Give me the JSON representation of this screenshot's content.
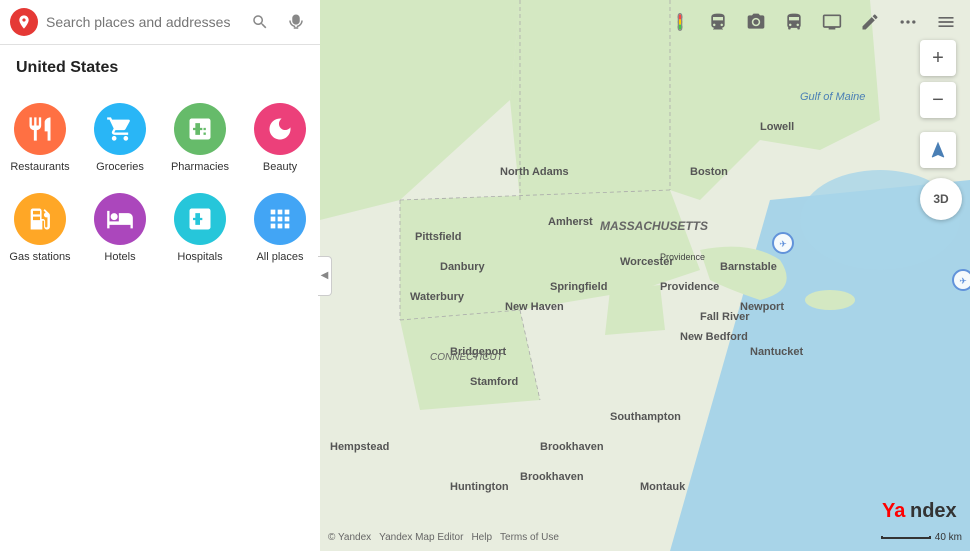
{
  "sidebar": {
    "search_placeholder": "Search places and addresses",
    "region_title": "United States"
  },
  "categories": [
    {
      "id": "restaurants",
      "label": "Restaurants",
      "icon_color": "icon-restaurants",
      "icon": "🍽"
    },
    {
      "id": "groceries",
      "label": "Groceries",
      "icon_color": "icon-groceries",
      "icon": "🛒"
    },
    {
      "id": "pharmacies",
      "label": "Pharmacies",
      "icon_color": "icon-pharmacies",
      "icon": "➕"
    },
    {
      "id": "beauty",
      "label": "Beauty",
      "icon_color": "icon-beauty",
      "icon": "💄"
    },
    {
      "id": "gas",
      "label": "Gas stations",
      "icon_color": "icon-gas",
      "icon": "⛽"
    },
    {
      "id": "hotels",
      "label": "Hotels",
      "icon_color": "icon-hotels",
      "icon": "🏨"
    },
    {
      "id": "hospitals",
      "label": "Hospitals",
      "icon_color": "icon-hospitals",
      "icon": "🏥"
    },
    {
      "id": "all",
      "label": "All places",
      "icon_color": "icon-all",
      "icon": "⋯"
    }
  ],
  "map": {
    "gulf_label": "Gulf of Maine",
    "scale_label": "40 km"
  },
  "toolbar": {
    "buttons": [
      "🔍",
      "🚗",
      "📷",
      "🚌",
      "🖥",
      "✏",
      "•••",
      "☰"
    ]
  },
  "footer": {
    "links": [
      "© Yandex",
      "Yandex Map Editor",
      "Help",
      "Terms of Use"
    ]
  },
  "icons": {
    "location": "📍",
    "search": "🔍",
    "voice": "🎤",
    "collapse": "◀",
    "zoom_in": "+",
    "zoom_out": "−",
    "compass": "◎",
    "threed": "3D"
  }
}
